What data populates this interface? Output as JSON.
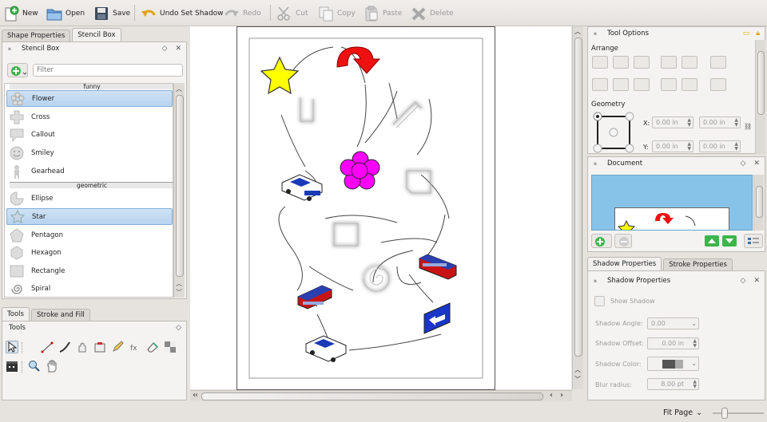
{
  "toolbar": {
    "new": "New",
    "open": "Open",
    "save": "Save",
    "undo": "Undo Set Shadow",
    "redo": "Redo",
    "cut": "Cut",
    "copy": "Copy",
    "paste": "Paste",
    "delete": "Delete"
  },
  "left_dock": {
    "tabs": [
      "Shape Properties",
      "Stencil Box"
    ],
    "stencil_title": "Stencil Box",
    "filter_placeholder": "Filter",
    "group_funny": "funny",
    "group_geometric": "geometric",
    "funny_items": [
      "Flower",
      "Cross",
      "Callout",
      "Smiley",
      "Gearhead"
    ],
    "geometric_items": [
      "Ellipse",
      "Star",
      "Pentagon",
      "Hexagon",
      "Rectangle",
      "Spiral"
    ],
    "selected_funny": "Flower",
    "selected_geometric": "Star"
  },
  "tools_dock": {
    "tabs": [
      "Tools",
      "Stroke and Fill"
    ],
    "title": "Tools"
  },
  "tool_options": {
    "title": "Tool Options",
    "arrange_label": "Arrange",
    "geometry_label": "Geometry",
    "x_label": "X:",
    "y_label": "Y:",
    "x_value": "0.00 in",
    "y_value": "0.00 in",
    "w_value": "0.00 in",
    "h_value": "0.00 in"
  },
  "document_dock": {
    "title": "Document"
  },
  "shadow": {
    "tabs": [
      "Shadow Properties",
      "Stroke Properties"
    ],
    "title": "Shadow Properties",
    "show_shadow": "Show Shadow",
    "angle_label": "Shadow Angle:",
    "angle_value": "0.00",
    "offset_label": "Shadow Offset:",
    "offset_value": "0.00 in",
    "color_label": "Shadow Color:",
    "blur_label": "Blur radius:",
    "blur_value": "8.00 pt"
  },
  "statusbar": {
    "zoom": "Fit Page"
  },
  "colors": {
    "selection": "#b7d3ef",
    "preview_bg": "#87c3e9",
    "star": "#ffff00",
    "flower": "#ff00ff",
    "arrow": "#ff0000"
  }
}
